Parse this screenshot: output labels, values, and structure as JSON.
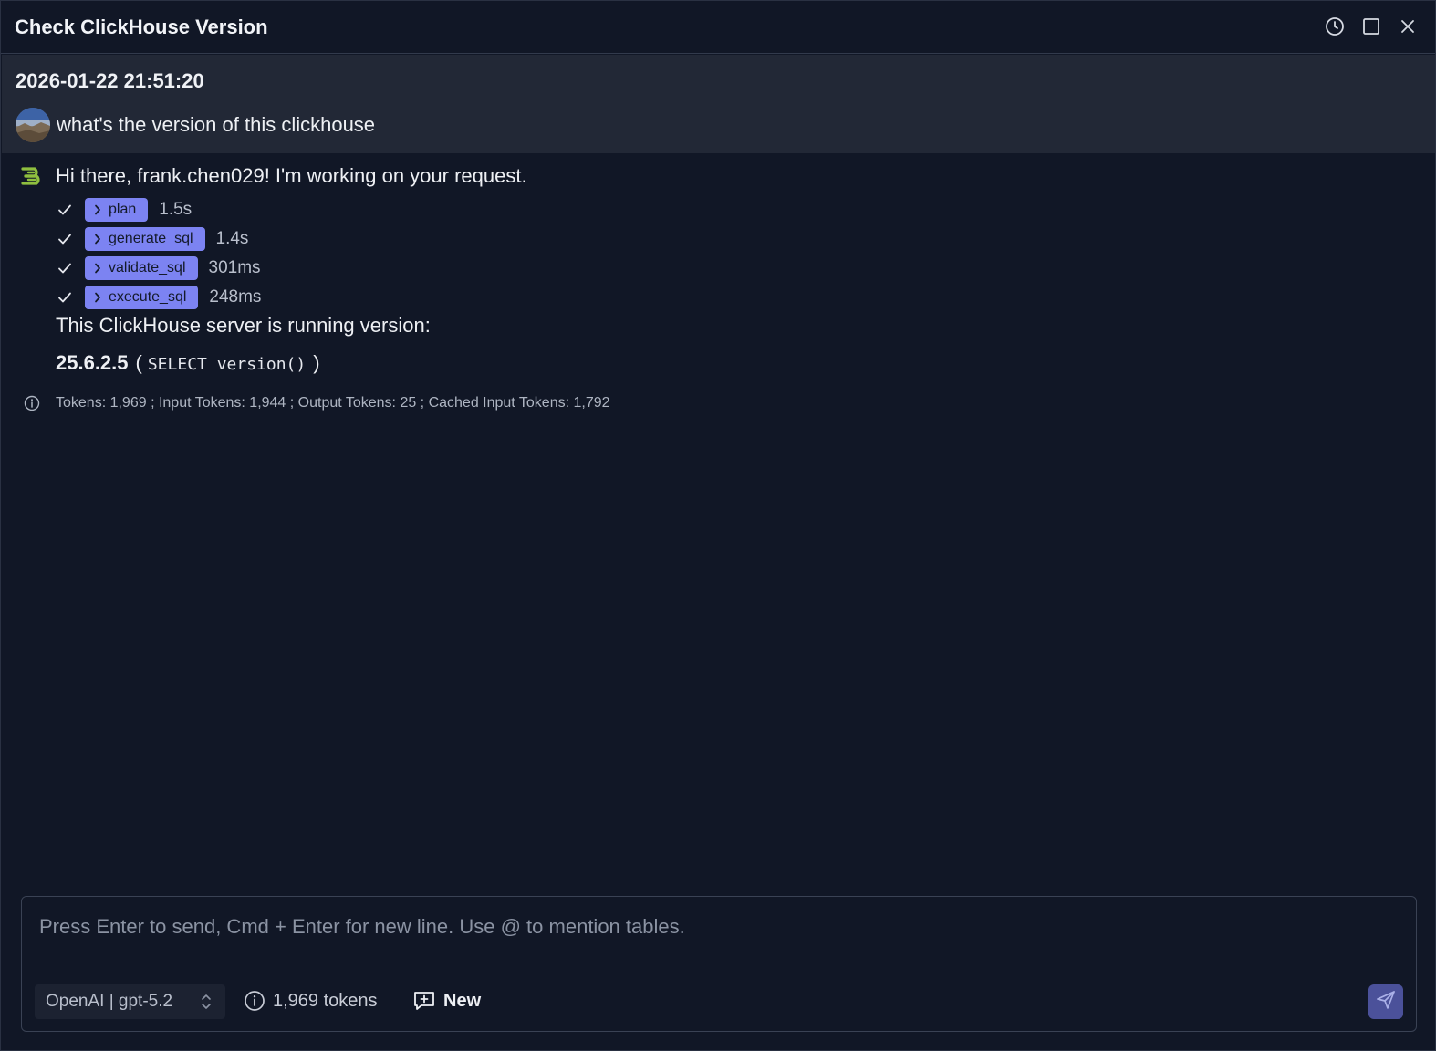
{
  "window": {
    "title": "Check ClickHouse Version",
    "controls": [
      "history-icon",
      "maximize-icon",
      "close-icon"
    ]
  },
  "user_message": {
    "timestamp": "2026-01-22 21:51:20",
    "text": "what's the version of this clickhouse"
  },
  "assistant": {
    "greeting": "Hi there, frank.chen029! I'm working on your request.",
    "steps": [
      {
        "name": "plan",
        "duration": "1.5s"
      },
      {
        "name": "generate_sql",
        "duration": "1.4s"
      },
      {
        "name": "validate_sql",
        "duration": "301ms"
      },
      {
        "name": "execute_sql",
        "duration": "248ms"
      }
    ],
    "answer_intro": "This ClickHouse server is running version:",
    "version": "25.6.2.5",
    "paren_open": "(",
    "query": "SELECT version()",
    "paren_close": ")",
    "token_stats": "Tokens: 1,969 ; Input Tokens: 1,944 ; Output Tokens: 25 ; Cached Input Tokens: 1,792"
  },
  "composer": {
    "placeholder": "Press Enter to send, Cmd + Enter for new line. Use @ to mention tables.",
    "model": "OpenAI | gpt-5.2",
    "token_count": "1,969 tokens",
    "new_label": "New"
  },
  "colors": {
    "background": "#111726",
    "user_block": "#222836",
    "tag": "#7c83f2",
    "send_button": "#4b519a",
    "bot_icon": "#8fbf3f"
  }
}
